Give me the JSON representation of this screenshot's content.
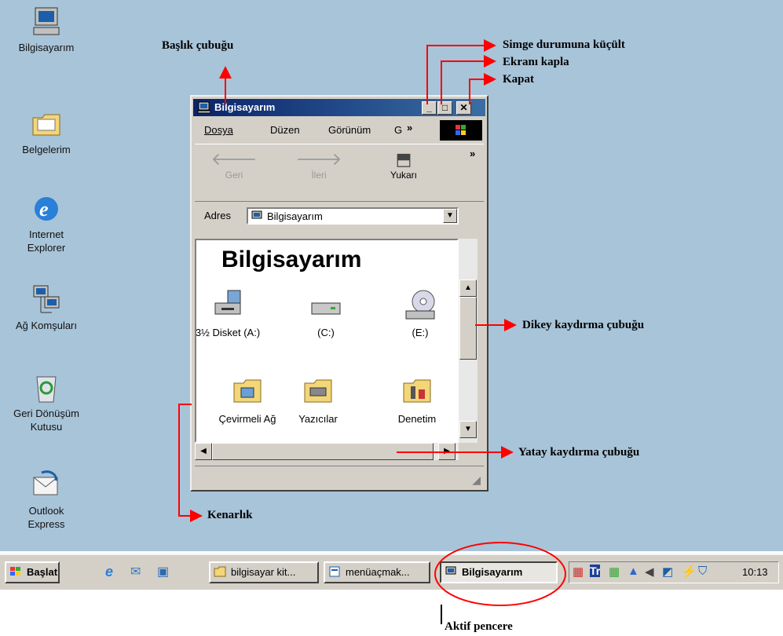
{
  "desktop_icons": [
    {
      "label": "Bilgisayarım",
      "icon": "computer-icon"
    },
    {
      "label": "Belgelerim",
      "icon": "folder-documents-icon"
    },
    {
      "label_lines": [
        "Internet",
        "Explorer"
      ],
      "icon": "internet-explorer-icon"
    },
    {
      "label": "Ağ Komşuları",
      "icon": "network-icon"
    },
    {
      "label_lines": [
        "Geri Dönüşüm",
        "Kutusu"
      ],
      "icon": "recycle-bin-icon"
    },
    {
      "label_lines": [
        "Outlook",
        "Express"
      ],
      "icon": "outlook-express-icon"
    }
  ],
  "window": {
    "title": "Bilgisayarım",
    "controls": {
      "minimize": "_",
      "maximize": "□",
      "close": "✕"
    },
    "menu": [
      "Dosya",
      "Düzen",
      "Görünüm",
      "G",
      "»"
    ],
    "toolbar": {
      "back": "Geri",
      "forward": "İleri",
      "up": "Yukarı",
      "more": "»"
    },
    "address": {
      "label": "Adres",
      "value": "Bilgisayarım"
    },
    "content_title": "Bilgisayarım",
    "items": [
      {
        "label": "3½ Disket (A:)",
        "icon": "floppy-drive-icon"
      },
      {
        "label": "(C:)",
        "icon": "hard-drive-icon"
      },
      {
        "label": "(E:)",
        "icon": "cd-drive-icon"
      },
      {
        "label": "Çevirmeli Ağ",
        "icon": "dialup-folder-icon"
      },
      {
        "label": "Yazıcılar",
        "icon": "printers-folder-icon"
      },
      {
        "label": "Denetim",
        "icon": "control-panel-folder-icon"
      }
    ]
  },
  "taskbar": {
    "start": "Başlat",
    "buttons": [
      "bilgisayar kit...",
      "menüaçmak...",
      "Bilgisayarım"
    ],
    "clock": "10:13"
  },
  "annotations": {
    "title_bar": "Başlık çubuğu",
    "minimize": "Simge durumuna küçült",
    "maximize": "Ekranı kapla",
    "close": "Kapat",
    "vertical_scroll": "Dikey kaydırma çubuğu",
    "horizontal_scroll": "Yatay kaydırma çubuğu",
    "border": "Kenarlık",
    "active_window": "Aktif pencere"
  },
  "colors": {
    "desktop": "#a8c4d9",
    "title_bar": "#0a246a",
    "arrows": "#ff0000",
    "window_face": "#d4d0c8"
  }
}
